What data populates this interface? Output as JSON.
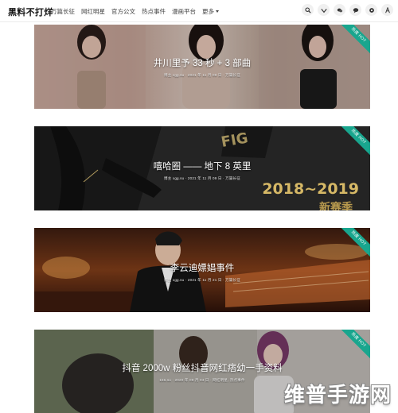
{
  "site": {
    "brand": "黑料不打烊"
  },
  "nav": {
    "items": [
      "万篇长征",
      "网红明星",
      "官方公文",
      "热点事件",
      "漫画平台"
    ],
    "more_label": "更多"
  },
  "header_icons": [
    "search-icon",
    "weibo-icon",
    "wechat-icon",
    "chat-icon",
    "settings-icon",
    "font-size-icon"
  ],
  "cards": [
    {
      "title": "井川里予 33 秒 + 3 部曲",
      "meta": "博主 xgg.su · 2021 年 11 月 09 日 · 万篇长征",
      "badge": "热度 HOT"
    },
    {
      "title": "嘻哈圈 —— 地下 8 英里",
      "meta": "博主 xgg.su · 2021 年 11 月 09 日 · 万篇长征",
      "badge": "热度 HOT",
      "poster_line1": "2018~2019",
      "poster_line2": "新赛季"
    },
    {
      "title": "李云迪嫖娼事件",
      "meta": "博主 xgg.su · 2021 年 11 月 21 日 · 万篇长征",
      "badge": "热度 HOT"
    },
    {
      "title": "抖音 2000w 粉丝抖音网红痞幼一手资料",
      "meta": "166.su · 2020 年 09 月 04 日 · 网红明星, 热点事件",
      "badge": "热度 HOT"
    }
  ],
  "watermark": "维普手游网"
}
